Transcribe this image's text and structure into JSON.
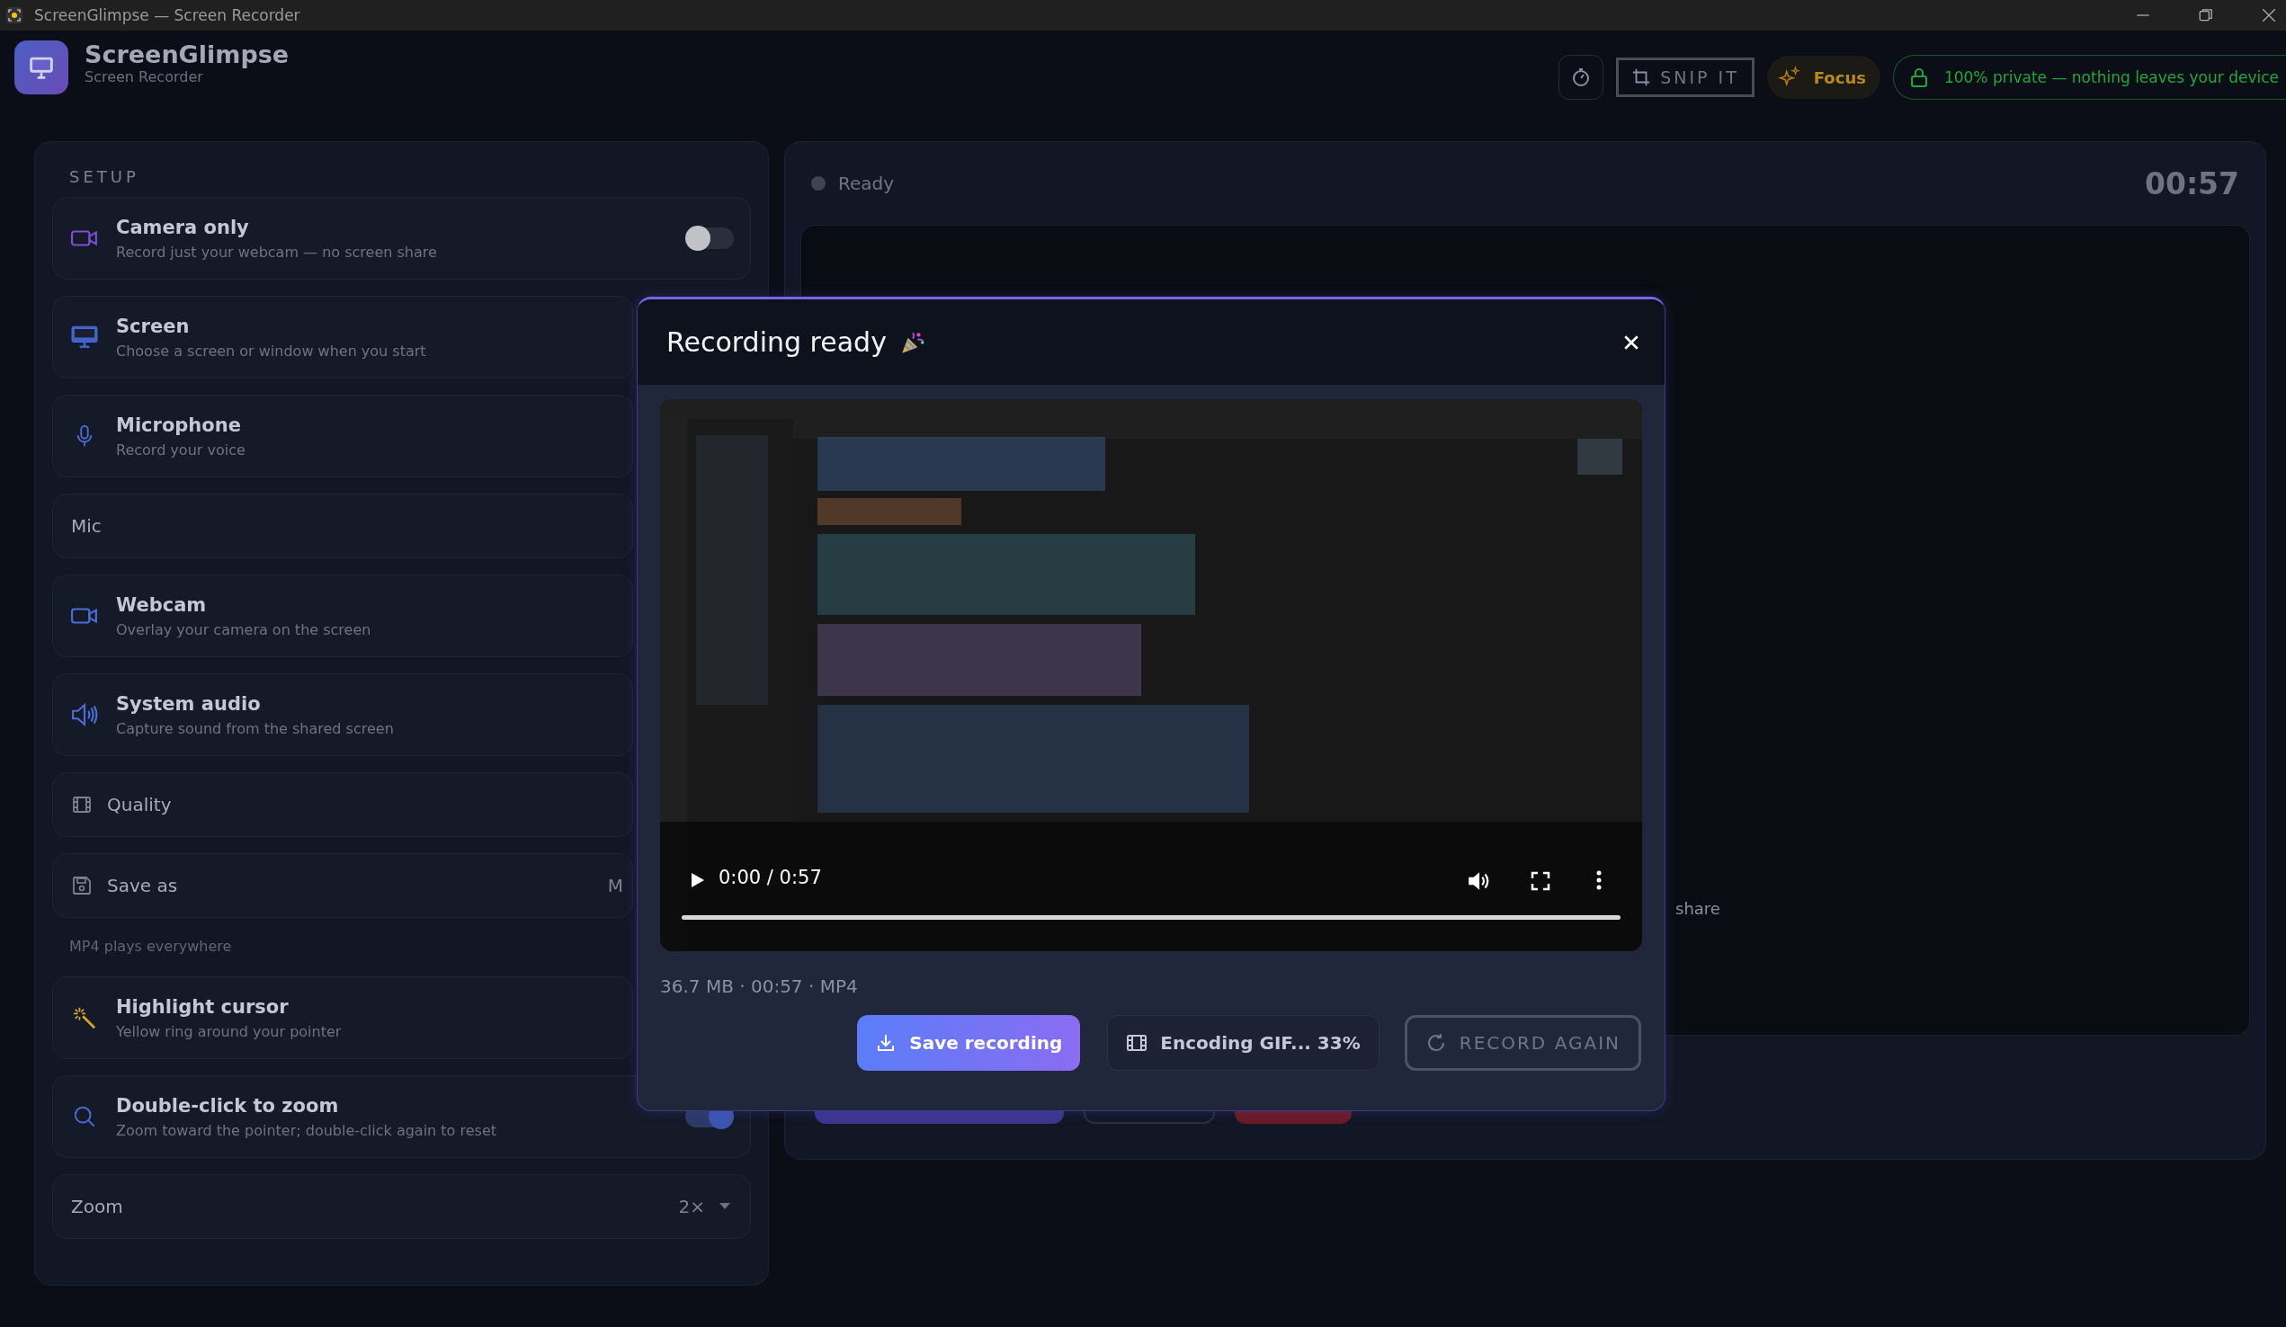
{
  "window": {
    "title": "ScreenGlimpse — Screen Recorder"
  },
  "app": {
    "name": "ScreenGlimpse",
    "subtitle": "Screen Recorder"
  },
  "toolbar": {
    "snip_label": "SNIP IT",
    "focus_label": "Focus",
    "privacy_text": "100% private — nothing leaves your device"
  },
  "setup": {
    "heading": "SETUP",
    "items": [
      {
        "kind": "toggle",
        "title": "Camera only",
        "description": "Record just your webcam — no screen share",
        "on": false
      },
      {
        "kind": "option",
        "title": "Screen",
        "description": "Choose a screen or window when you start"
      },
      {
        "kind": "option",
        "title": "Microphone",
        "description": "Record your voice"
      },
      {
        "kind": "select",
        "label": "Mic"
      },
      {
        "kind": "option",
        "title": "Webcam",
        "description": "Overlay your camera on the screen"
      },
      {
        "kind": "option",
        "title": "System audio",
        "description": "Capture sound from the shared screen"
      },
      {
        "kind": "select",
        "label": "Quality"
      },
      {
        "kind": "select",
        "label": "Save as",
        "value": "M"
      },
      {
        "kind": "hint",
        "text": "MP4 plays everywhere"
      },
      {
        "kind": "option",
        "title": "Highlight cursor",
        "description": "Yellow ring around your pointer"
      },
      {
        "kind": "toggle",
        "title": "Double-click to zoom",
        "description": "Zoom toward the pointer; double-click again to reset",
        "on": true
      },
      {
        "kind": "select",
        "label": "Zoom",
        "value": "2×",
        "dropdown": true
      }
    ]
  },
  "preview": {
    "status": "Ready",
    "timer": "00:57",
    "hint": "share"
  },
  "modal": {
    "title": "Recording ready",
    "player": {
      "time": "0:00 / 0:57"
    },
    "file_info": "36.7 MB · 00:57 · MP4",
    "buttons": [
      {
        "kind": "primary",
        "label": "Save recording"
      },
      {
        "kind": "status",
        "label": "Encoding GIF... 33%"
      },
      {
        "kind": "outline",
        "label": "RECORD AGAIN"
      }
    ]
  }
}
